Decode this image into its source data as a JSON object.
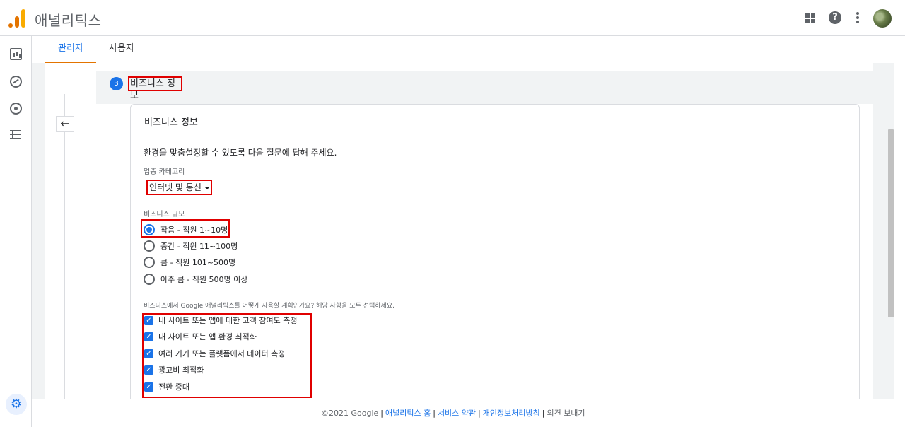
{
  "app": {
    "title": "애널리틱스"
  },
  "header": {
    "apps_icon": "apps-grid-icon",
    "help_icon": "help-circle-icon",
    "more_icon": "more-vert-icon",
    "avatar": "account-avatar"
  },
  "leftrail": {
    "items": [
      "reports-icon",
      "explore-icon",
      "advertising-icon",
      "configure-icon"
    ],
    "admin_icon": "settings-gear-icon"
  },
  "tabs": [
    {
      "label": "관리자",
      "active": true
    },
    {
      "label": "사용자",
      "active": false
    }
  ],
  "step": {
    "number": "3",
    "label": "비즈니스 정보"
  },
  "card": {
    "title": "비즈니스 정보",
    "intro": "환경을 맞춤설정할 수 있도록 다음 질문에 답해 주세요.",
    "industry": {
      "label": "업종 카테고리",
      "value": "인터넷 및 통신"
    },
    "size": {
      "label": "비즈니스 규모",
      "options": [
        {
          "label": "작음 - 직원 1~10명",
          "selected": true
        },
        {
          "label": "중간 - 직원 11~100명",
          "selected": false
        },
        {
          "label": "큼 - 직원 101~500명",
          "selected": false
        },
        {
          "label": "아주 큼 - 직원 500명 이상",
          "selected": false
        }
      ]
    },
    "usage": {
      "label": "비즈니스에서 Google 애널리틱스를 어떻게 사용할 계획인가요? 해당 사항을 모두 선택하세요.",
      "options": [
        {
          "label": "내 사이트 또는 앱에 대한 고객 참여도 측정",
          "checked": true
        },
        {
          "label": "내 사이트 또는 앱 환경 최적화",
          "checked": true
        },
        {
          "label": "여러 기기 또는 플랫폼에서 데이터 측정",
          "checked": true
        },
        {
          "label": "광고비 최적화",
          "checked": true
        },
        {
          "label": "전환 증대",
          "checked": true
        }
      ]
    }
  },
  "footer": {
    "copyright": "©2021 Google",
    "home": "애널리틱스 홈",
    "terms": "서비스 약관",
    "privacy": "개인정보처리방침",
    "feedback": "의견 보내기"
  },
  "colors": {
    "accent": "#1a73e8",
    "highlight": "#e00000",
    "tab_underline": "#e37400"
  }
}
